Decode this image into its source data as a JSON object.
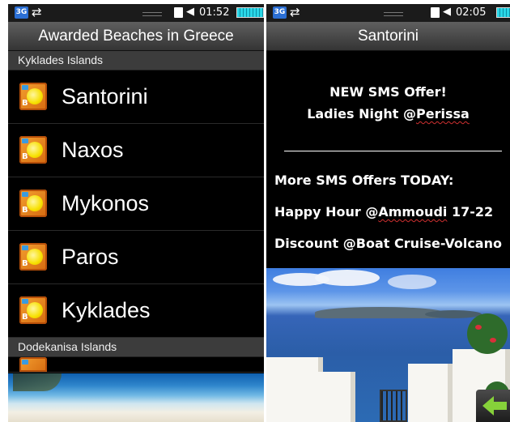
{
  "left": {
    "status": {
      "network": "3G",
      "sync_icon": "sync-icon",
      "time": "01:52"
    },
    "title": "Awarded Beaches in Greece",
    "sections": [
      {
        "label": "Kyklades Islands"
      },
      {
        "label": "Dodekanisa Islands"
      }
    ],
    "items": [
      {
        "label": "Santorini",
        "badge": "B"
      },
      {
        "label": "Naxos",
        "badge": "B"
      },
      {
        "label": "Mykonos",
        "badge": "B"
      },
      {
        "label": "Paros",
        "badge": "B"
      },
      {
        "label": "Kyklades",
        "badge": "B"
      }
    ]
  },
  "right": {
    "status": {
      "network": "3G",
      "sync_icon": "sync-icon",
      "time": "02:05"
    },
    "title": "Santorini",
    "offer_title": "NEW SMS Offer!",
    "offer_sub_prefix": "Ladies Night @",
    "offer_sub_place": "Perissa",
    "more_heading": "More SMS Offers TODAY:",
    "line1_prefix": "Happy Hour @",
    "line1_place": "Ammoudi",
    "line1_suffix": " 17-22",
    "line2": "Discount @Boat Cruise-Volcano",
    "back_icon": "back-arrow-icon",
    "colors": {
      "accent_green": "#86d13a",
      "battery": "#29d7e7"
    }
  }
}
